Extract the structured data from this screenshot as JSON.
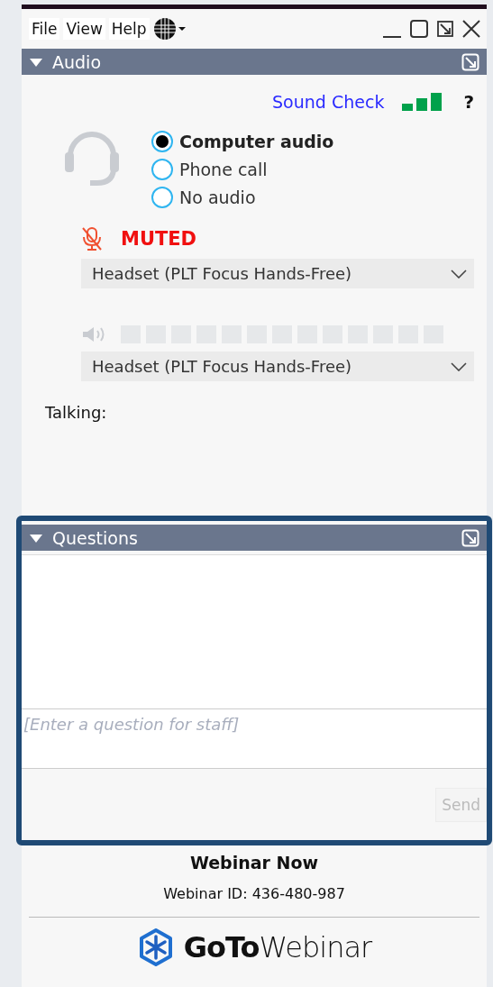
{
  "menu": [
    {
      "label": "File"
    },
    {
      "label": "View"
    },
    {
      "label": "Help"
    }
  ],
  "audio": {
    "title": "Audio",
    "expanded": true,
    "sound_check": "Sound Check",
    "help": "?",
    "options": [
      {
        "label": "Computer audio",
        "selected": true
      },
      {
        "label": "Phone call",
        "selected": false
      },
      {
        "label": "No audio",
        "selected": false
      }
    ],
    "mic_status": "MUTED",
    "muted": true,
    "microphone": "Headset (PLT Focus Hands-Free)",
    "speaker": "Headset (PLT Focus Hands-Free)",
    "talking": "Talking:"
  },
  "questions": {
    "title": "Questions",
    "expanded": true,
    "placeholder": "[Enter a question for staff]",
    "send": "Send",
    "send_disabled": true
  },
  "footer": {
    "title": "Webinar Now",
    "webinar_id": "Webinar ID: 436-480-987",
    "logo": "**GoTo**Webinar"
  }
}
